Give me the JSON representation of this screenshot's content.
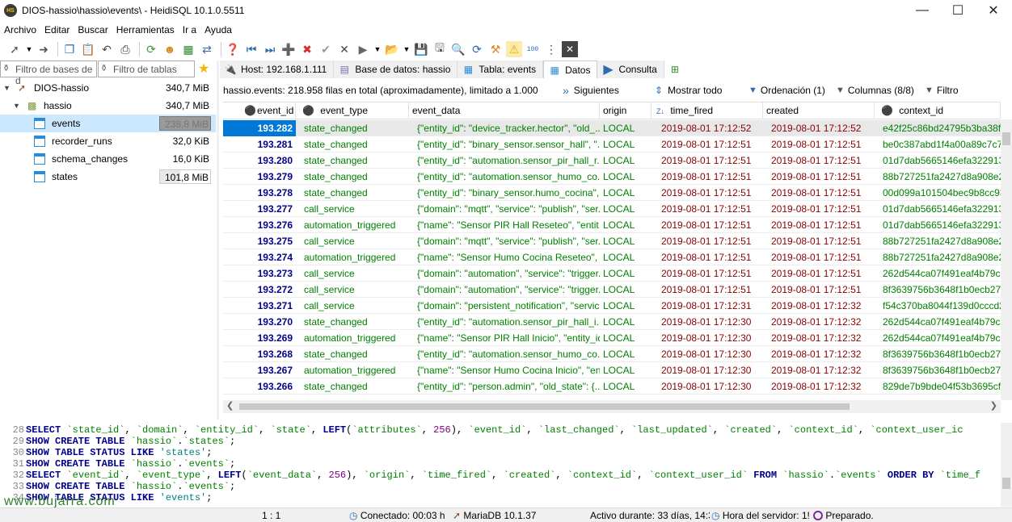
{
  "window": {
    "title": "DIOS-hassio\\hassio\\events\\ - HeidiSQL 10.1.0.5511",
    "icon_label": "HS"
  },
  "menu": [
    "Archivo",
    "Editar",
    "Buscar",
    "Herramientas",
    "Ir a",
    "Ayuda"
  ],
  "left": {
    "filter_db_placeholder": "Filtro de bases de d",
    "filter_tbl_placeholder": "Filtro de tablas",
    "tree": [
      {
        "label": "DIOS-hassio",
        "size": "340,7 MiB",
        "level": 0,
        "kind": "server"
      },
      {
        "label": "hassio",
        "size": "340,7 MiB",
        "level": 1,
        "kind": "database"
      },
      {
        "label": "events",
        "size": "238,8 MiB",
        "level": 2,
        "kind": "table",
        "selected": true
      },
      {
        "label": "recorder_runs",
        "size": "32,0 KiB",
        "level": 2,
        "kind": "table"
      },
      {
        "label": "schema_changes",
        "size": "16,0 KiB",
        "level": 2,
        "kind": "table"
      },
      {
        "label": "states",
        "size": "101,8 MiB",
        "level": 2,
        "kind": "table"
      }
    ]
  },
  "tabs": [
    {
      "label": "Host: 192.168.1.111",
      "icon": "host-icon"
    },
    {
      "label": "Base de datos: hassio",
      "icon": "database-icon"
    },
    {
      "label": "Tabla: events",
      "icon": "table-icon"
    },
    {
      "label": "Datos",
      "icon": "grid-icon",
      "active": true
    },
    {
      "label": "Consulta",
      "icon": "play-icon"
    }
  ],
  "gridbar": {
    "info": "hassio.events: 218.958 filas en total (aproximadamente), limitado a 1.000",
    "next": "Siguientes",
    "show_all": "Mostrar todo",
    "sort": "Ordenación (1)",
    "columns": "Columnas (8/8)",
    "filter": "Filtro"
  },
  "grid": {
    "columns": [
      "event_id",
      "event_type",
      "event_data",
      "origin",
      "time_fired",
      "created",
      "context_id"
    ],
    "rows": [
      [
        "193.282",
        "state_changed",
        "{\"entity_id\": \"device_tracker.hector\", \"old_...",
        "LOCAL",
        "2019-08-01 17:12:52",
        "2019-08-01 17:12:52",
        "e42f25c86bd24795b3ba38f2"
      ],
      [
        "193.281",
        "state_changed",
        "{\"entity_id\": \"binary_sensor.sensor_hall\", \"...",
        "LOCAL",
        "2019-08-01 17:12:51",
        "2019-08-01 17:12:51",
        "be0c387abd1f4a00a89c7c7c"
      ],
      [
        "193.280",
        "state_changed",
        "{\"entity_id\": \"automation.sensor_pir_hall_r...",
        "LOCAL",
        "2019-08-01 17:12:51",
        "2019-08-01 17:12:51",
        "01d7dab5665146efa322913"
      ],
      [
        "193.279",
        "state_changed",
        "{\"entity_id\": \"automation.sensor_humo_co...",
        "LOCAL",
        "2019-08-01 17:12:51",
        "2019-08-01 17:12:51",
        "88b727251fa2427d8a908e2("
      ],
      [
        "193.278",
        "state_changed",
        "{\"entity_id\": \"binary_sensor.humo_cocina\",...",
        "LOCAL",
        "2019-08-01 17:12:51",
        "2019-08-01 17:12:51",
        "00d099a101504bec9b8cc93f"
      ],
      [
        "193.277",
        "call_service",
        "{\"domain\": \"mqtt\", \"service\": \"publish\", \"ser...",
        "LOCAL",
        "2019-08-01 17:12:51",
        "2019-08-01 17:12:51",
        "01d7dab5665146efa322913"
      ],
      [
        "193.276",
        "automation_triggered",
        "{\"name\": \"Sensor PIR Hall Reseteo\", \"entit...",
        "LOCAL",
        "2019-08-01 17:12:51",
        "2019-08-01 17:12:51",
        "01d7dab5665146efa322913"
      ],
      [
        "193.275",
        "call_service",
        "{\"domain\": \"mqtt\", \"service\": \"publish\", \"ser...",
        "LOCAL",
        "2019-08-01 17:12:51",
        "2019-08-01 17:12:51",
        "88b727251fa2427d8a908e2("
      ],
      [
        "193.274",
        "automation_triggered",
        "{\"name\": \"Sensor Humo Cocina Reseteo\", \"...",
        "LOCAL",
        "2019-08-01 17:12:51",
        "2019-08-01 17:12:51",
        "88b727251fa2427d8a908e2("
      ],
      [
        "193.273",
        "call_service",
        "{\"domain\": \"automation\", \"service\": \"trigger...",
        "LOCAL",
        "2019-08-01 17:12:51",
        "2019-08-01 17:12:51",
        "262d544ca07f491eaf4b79ca"
      ],
      [
        "193.272",
        "call_service",
        "{\"domain\": \"automation\", \"service\": \"trigger...",
        "LOCAL",
        "2019-08-01 17:12:51",
        "2019-08-01 17:12:51",
        "8f3639756b3648f1b0ecb271"
      ],
      [
        "193.271",
        "call_service",
        "{\"domain\": \"persistent_notification\", \"servic...",
        "LOCAL",
        "2019-08-01 17:12:31",
        "2019-08-01 17:12:32",
        "f54c370ba8044f139d0cccd2("
      ],
      [
        "193.270",
        "state_changed",
        "{\"entity_id\": \"automation.sensor_pir_hall_i...",
        "LOCAL",
        "2019-08-01 17:12:30",
        "2019-08-01 17:12:32",
        "262d544ca07f491eaf4b79ca"
      ],
      [
        "193.269",
        "automation_triggered",
        "{\"name\": \"Sensor PIR Hall Inicio\", \"entity_id...",
        "LOCAL",
        "2019-08-01 17:12:30",
        "2019-08-01 17:12:32",
        "262d544ca07f491eaf4b79ca"
      ],
      [
        "193.268",
        "state_changed",
        "{\"entity_id\": \"automation.sensor_humo_co...",
        "LOCAL",
        "2019-08-01 17:12:30",
        "2019-08-01 17:12:32",
        "8f3639756b3648f1b0ecb271"
      ],
      [
        "193.267",
        "automation_triggered",
        "{\"name\": \"Sensor Humo Cocina Inicio\", \"ent...",
        "LOCAL",
        "2019-08-01 17:12:30",
        "2019-08-01 17:12:32",
        "8f3639756b3648f1b0ecb271"
      ],
      [
        "193.266",
        "state_changed",
        "{\"entity_id\": \"person.admin\", \"old_state\": {...",
        "LOCAL",
        "2019-08-01 17:12:30",
        "2019-08-01 17:12:32",
        "829de7b9bde04f53b3695cfc"
      ]
    ]
  },
  "sql_log": [
    {
      "n": "28",
      "html": "<span class=\"kw\">SELECT</span>  <span class=\"tx\">`state_id`</span>,  <span class=\"tx\">`domain`</span>,  <span class=\"tx\">`entity_id`</span>,  <span class=\"tx\">`state`</span>,  <span class=\"kw\">LEFT</span>(<span class=\"tx\">`attributes`</span>, <span class=\"num\">256</span>),  <span class=\"tx\">`event_id`</span>,  <span class=\"tx\">`last_changed`</span>,  <span class=\"tx\">`last_updated`</span>,  <span class=\"tx\">`created`</span>,  <span class=\"tx\">`context_id`</span>,  <span class=\"tx\">`context_user_ic</span>"
    },
    {
      "n": "29",
      "html": "<span class=\"kw\">SHOW CREATE TABLE</span> <span class=\"tx\">`hassio`</span>.<span class=\"tx\">`states`</span>;"
    },
    {
      "n": "30",
      "html": "<span class=\"kw\">SHOW TABLE STATUS LIKE</span> <span class=\"str\">'states'</span>;"
    },
    {
      "n": "31",
      "html": "<span class=\"kw\">SHOW CREATE TABLE</span> <span class=\"tx\">`hassio`</span>.<span class=\"tx\">`events`</span>;"
    },
    {
      "n": "32",
      "html": "<span class=\"kw\">SELECT</span>  <span class=\"tx\">`event_id`</span>,  <span class=\"tx\">`event_type`</span>,  <span class=\"kw\">LEFT</span>(<span class=\"tx\">`event_data`</span>, <span class=\"num\">256</span>),  <span class=\"tx\">`origin`</span>,  <span class=\"tx\">`time_fired`</span>,  <span class=\"tx\">`created`</span>,  <span class=\"tx\">`context_id`</span>,  <span class=\"tx\">`context_user_id`</span> <span class=\"kw\">FROM</span> <span class=\"tx\">`hassio`</span>.<span class=\"tx\">`events`</span> <span class=\"kw\">ORDER BY</span> <span class=\"tx\">`time_f</span>"
    },
    {
      "n": "33",
      "html": "<span class=\"kw\">SHOW CREATE TABLE</span> <span class=\"tx\">`hassio`</span>.<span class=\"tx\">`events`</span>;"
    },
    {
      "n": "34",
      "html": "<span class=\"kw\">SHOW TABLE STATUS LIKE</span> <span class=\"str\">'events'</span>;"
    }
  ],
  "status": {
    "position": "1 : 1",
    "connected": "Conectado: 00:03 h",
    "server_version": "MariaDB 10.1.37",
    "uptime": "Activo durante: 33 días, 14:3",
    "server_time": "Hora del servidor: 1!",
    "state": "Preparado."
  },
  "watermark": "www.bujarra.com",
  "colors": {
    "selection": "#0078d7",
    "id_text": "#00008b",
    "string_text": "#008000",
    "date_text": "#8b0000"
  }
}
